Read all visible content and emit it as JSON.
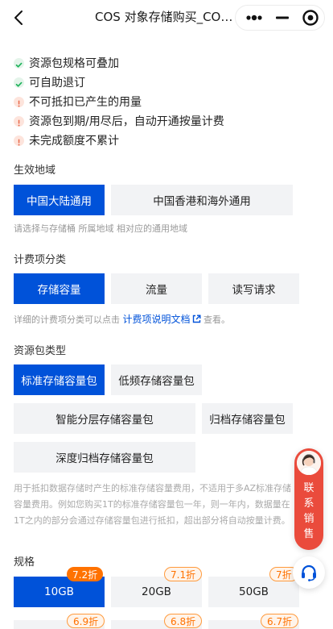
{
  "header": {
    "title": "COS 对象存储购买_COS对象存储"
  },
  "features": [
    {
      "type": "ok",
      "text": "资源包规格可叠加"
    },
    {
      "type": "ok",
      "text": "可自助退订"
    },
    {
      "type": "warn",
      "text": "不可抵扣已产生的用量"
    },
    {
      "type": "warn",
      "text": "资源包到期/用尽后，自动开通按量计费"
    },
    {
      "type": "warn",
      "text": "未完成额度不累计"
    }
  ],
  "region": {
    "title": "生效地域",
    "options": [
      "中国大陆通用",
      "中国香港和海外通用"
    ],
    "hint": "请选择与存储桶 所属地域 相对应的通用地域"
  },
  "billing": {
    "title": "计费项分类",
    "options": [
      "存储容量",
      "流量",
      "读写请求"
    ],
    "hint_prefix": "详细的计费项分类可以点击",
    "hint_link": "计费项说明文档",
    "hint_suffix": "查看。"
  },
  "package": {
    "title": "资源包类型",
    "options": [
      "标准存储容量包",
      "低频存储容量包",
      "智能分层存储容量包",
      "归档存储容量包",
      "深度归档存储容量包"
    ],
    "desc": "用于抵扣数据存储时产生的标准存储容量费用，不适用于多AZ标准存储容量费用。例如您购买1T的标准存储容量包一年，则一年内，数据量在1T之内的部分会通过存储容量包进行抵扣，超出部分将自动按量计费。"
  },
  "spec": {
    "title": "规格",
    "options": [
      {
        "label": "10GB",
        "badge": "7.2折"
      },
      {
        "label": "20GB",
        "badge": "7.1折"
      },
      {
        "label": "50GB",
        "badge": "7折"
      },
      {
        "label": "",
        "badge": "6.9折"
      },
      {
        "label": "",
        "badge": "6.8折"
      },
      {
        "label": "",
        "badge": "6.7折"
      }
    ]
  },
  "sales": {
    "text": [
      "联",
      "系",
      "销",
      "售"
    ]
  },
  "colors": {
    "primary": "#0052d9",
    "badge": "#ff7200",
    "sales": "#ea4b3c"
  }
}
